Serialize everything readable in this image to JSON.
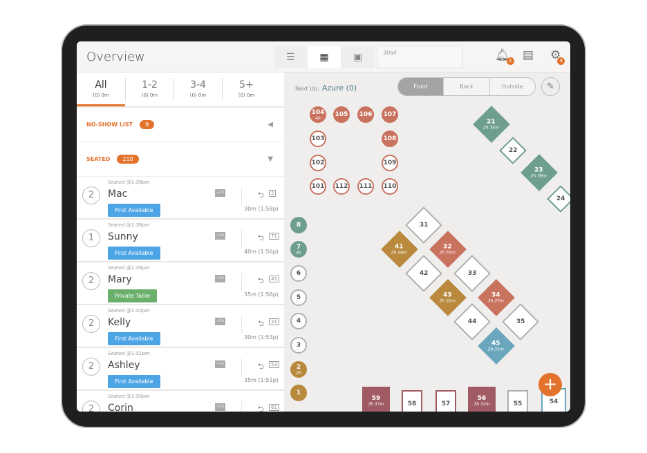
{
  "header": {
    "title": "Overview",
    "note_text": "30all",
    "view_icons": [
      "list-icon",
      "floor-list-icon",
      "floor-plan-icon"
    ],
    "notifications_count": "1",
    "settings_count": "4"
  },
  "party_tabs": [
    {
      "label": "All",
      "sub": "(0) 0m"
    },
    {
      "label": "1-2",
      "sub": "(0) 0m"
    },
    {
      "label": "3-4",
      "sub": "(0) 0m"
    },
    {
      "label": "5+",
      "sub": "(0) 0m"
    }
  ],
  "noshow": {
    "label": "NO-SHOW LIST",
    "count": "9"
  },
  "seated": {
    "label": "SEATED",
    "count": "210"
  },
  "rows": [
    {
      "party": "2",
      "seated": "Seated @1:58pm",
      "name": "Mac",
      "tag": "First Available",
      "tag_color": "#4ea5e6",
      "msg": "+2h",
      "table": "2",
      "time": "30m  (1:58p)"
    },
    {
      "party": "1",
      "seated": "Seated @1:56pm",
      "name": "Sunny",
      "tag": "First Available",
      "tag_color": "#4ea5e6",
      "msg": "+2h",
      "table": "71",
      "time": "40m  (1:56p)"
    },
    {
      "party": "2",
      "seated": "Seated @1:56pm",
      "name": "Mary",
      "tag": "Private Table",
      "tag_color": "#6bb06a",
      "msg": "+2h",
      "table": "45",
      "time": "35m  (1:56p)"
    },
    {
      "party": "2",
      "seated": "Seated @1:53pm",
      "name": "Kelly",
      "tag": "First Available",
      "tag_color": "#4ea5e6",
      "msg": "+2h",
      "table": "21",
      "time": "30m  (1:53p)"
    },
    {
      "party": "2",
      "seated": "Seated @1:51pm",
      "name": "Ashley",
      "tag": "First Available",
      "tag_color": "#4ea5e6",
      "msg": "+2h",
      "table": "53",
      "time": "35m  (1:51p)"
    },
    {
      "party": "2",
      "seated": "Seated @1:50pm",
      "name": "Corin",
      "tag": "",
      "tag_color": "#4ea5e6",
      "msg": "+2h",
      "table": "61",
      "time": ""
    }
  ],
  "floor": {
    "next_up_label": "Next Up:",
    "next_up_value": "Azure (0)",
    "areas": [
      "Front",
      "Back",
      "Outside"
    ],
    "active_area": "Front",
    "fab": "+"
  },
  "colors": {
    "teal": "#6e9e8f",
    "terracotta": "#c9735f",
    "gold": "#b9893e",
    "blue": "#6aa7bd",
    "maroon": "#a05a64",
    "gray": "#b0b0b0",
    "accent": "#e3732c"
  },
  "tables": [
    {
      "id": "104",
      "shape": "round",
      "status": "terracotta",
      "time": "4h"
    },
    {
      "id": "105",
      "shape": "round",
      "status": "terracotta",
      "time": ""
    },
    {
      "id": "106",
      "shape": "round",
      "status": "terracotta",
      "time": ""
    },
    {
      "id": "107",
      "shape": "round",
      "status": "terracotta",
      "time": ""
    },
    {
      "id": "103",
      "shape": "round",
      "status": "terracotta-outline",
      "time": ""
    },
    {
      "id": "108",
      "shape": "round",
      "status": "terracotta",
      "time": ""
    },
    {
      "id": "102",
      "shape": "round",
      "status": "terracotta-outline",
      "time": ""
    },
    {
      "id": "109",
      "shape": "round",
      "status": "terracotta-outline",
      "time": ""
    },
    {
      "id": "101",
      "shape": "round",
      "status": "terracotta-outline",
      "time": ""
    },
    {
      "id": "112",
      "shape": "round",
      "status": "terracotta-outline",
      "time": ""
    },
    {
      "id": "111",
      "shape": "round",
      "status": "terracotta-outline",
      "time": ""
    },
    {
      "id": "110",
      "shape": "round",
      "status": "terracotta-outline",
      "time": ""
    },
    {
      "id": "8",
      "shape": "round",
      "status": "teal",
      "time": ""
    },
    {
      "id": "7",
      "shape": "round",
      "status": "teal",
      "time": "3h"
    },
    {
      "id": "6",
      "shape": "round",
      "status": "gray-outline",
      "time": ""
    },
    {
      "id": "5",
      "shape": "round",
      "status": "gray-outline",
      "time": ""
    },
    {
      "id": "4",
      "shape": "round",
      "status": "gray-outline",
      "time": ""
    },
    {
      "id": "3",
      "shape": "round",
      "status": "gray-outline",
      "time": ""
    },
    {
      "id": "2",
      "shape": "round",
      "status": "gold",
      "time": "2h"
    },
    {
      "id": "1",
      "shape": "round",
      "status": "gold",
      "time": ""
    },
    {
      "id": "21",
      "shape": "diamond",
      "status": "teal",
      "time": "2h 34m"
    },
    {
      "id": "22",
      "shape": "diamond",
      "status": "teal-outline",
      "time": ""
    },
    {
      "id": "23",
      "shape": "diamond",
      "status": "teal",
      "time": "2h 59m"
    },
    {
      "id": "24",
      "shape": "diamond",
      "status": "teal-outline",
      "time": ""
    },
    {
      "id": "31",
      "shape": "diamond",
      "status": "gray-outline",
      "time": ""
    },
    {
      "id": "41",
      "shape": "diamond",
      "status": "gold",
      "time": "2h 48m"
    },
    {
      "id": "32",
      "shape": "diamond",
      "status": "terracotta",
      "time": "2h 55m"
    },
    {
      "id": "42",
      "shape": "diamond",
      "status": "gray-outline",
      "time": ""
    },
    {
      "id": "33",
      "shape": "diamond",
      "status": "gray-outline",
      "time": ""
    },
    {
      "id": "43",
      "shape": "diamond",
      "status": "gold",
      "time": "2h 51m"
    },
    {
      "id": "34",
      "shape": "diamond",
      "status": "terracotta",
      "time": "3h 27m"
    },
    {
      "id": "44",
      "shape": "diamond",
      "status": "gray-outline",
      "time": ""
    },
    {
      "id": "35",
      "shape": "diamond",
      "status": "gray-outline",
      "time": ""
    },
    {
      "id": "45",
      "shape": "diamond",
      "status": "blue",
      "time": "2h 31m"
    },
    {
      "id": "59",
      "shape": "square",
      "status": "maroon",
      "time": "3h 37m"
    },
    {
      "id": "58",
      "shape": "square",
      "status": "maroon-outline",
      "time": ""
    },
    {
      "id": "57",
      "shape": "square",
      "status": "maroon-outline",
      "time": ""
    },
    {
      "id": "56",
      "shape": "square",
      "status": "maroon",
      "time": "3h 32m"
    },
    {
      "id": "55",
      "shape": "square",
      "status": "gray-outline",
      "time": ""
    },
    {
      "id": "54",
      "shape": "square",
      "status": "blue-outline",
      "time": ""
    }
  ]
}
